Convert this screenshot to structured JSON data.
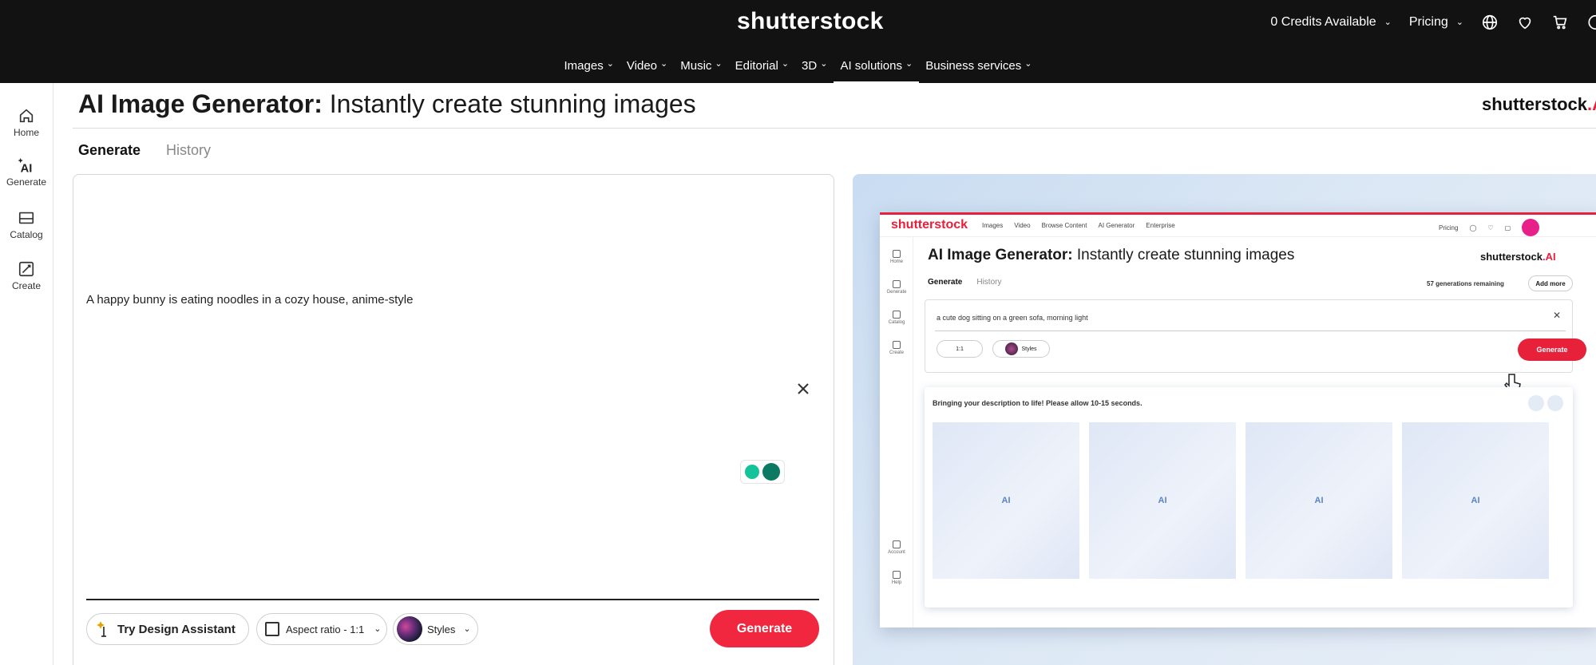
{
  "topbar": {
    "logo": "shutterstock",
    "credits": "0 Credits Available",
    "pricing": "Pricing",
    "nav": [
      {
        "label": "Images"
      },
      {
        "label": "Video"
      },
      {
        "label": "Music"
      },
      {
        "label": "Editorial"
      },
      {
        "label": "3D"
      },
      {
        "label": "AI solutions",
        "active": true
      },
      {
        "label": "Business services"
      }
    ],
    "icons": [
      "globe-icon",
      "heart-icon",
      "cart-icon"
    ]
  },
  "rail": [
    {
      "label": "Home",
      "icon": "home-icon"
    },
    {
      "label": "Generate",
      "icon": "ai-sparkle-icon"
    },
    {
      "label": "Catalog",
      "icon": "catalog-icon"
    },
    {
      "label": "Create",
      "icon": "create-icon"
    }
  ],
  "header": {
    "title_bold": "AI Image Generator:",
    "title_rest": " Instantly create stunning images",
    "brand": "shutterstock",
    "brand_mark": ".AI"
  },
  "tabs": [
    {
      "label": "Generate",
      "active": true
    },
    {
      "label": "History",
      "active": false
    }
  ],
  "prompt": {
    "value": "A happy bunny is eating noodles in a cozy house, anime-style",
    "design_assistant": "Try Design Assistant",
    "aspect_ratio": "Aspect ratio - 1:1",
    "styles": "Styles",
    "generate": "Generate"
  },
  "colors": {
    "accent": "#f0273f",
    "topbar": "#121212"
  },
  "preview": {
    "logo": "shutterstock",
    "nav": [
      "Images",
      "Video",
      "Browse Content",
      "AI Generator",
      "Enterprise"
    ],
    "pricing": "Pricing",
    "title_bold": "AI Image Generator:",
    "title_rest": " Instantly create stunning images",
    "brand": "shutterstock",
    "brand_mark": ".AI",
    "tabs": [
      "Generate",
      "History"
    ],
    "remaining": "57 generations remaining",
    "add_more": "Add more",
    "prompt": "a cute dog sitting on a green sofa, morning light",
    "aspect": "1:1",
    "styles": "Styles",
    "generate": "Generate",
    "rail": [
      "Home",
      "Generate",
      "Catalog",
      "Create",
      "Account",
      "Help"
    ],
    "status": "Bringing your description to life! Please allow 10-15 seconds.",
    "tile_label": "AI"
  }
}
